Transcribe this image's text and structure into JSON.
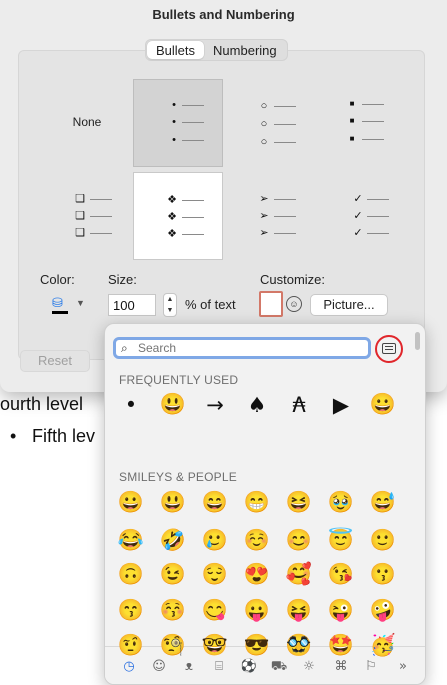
{
  "window": {
    "title": "Bullets and Numbering"
  },
  "tabs": [
    {
      "label": "Bullets",
      "active": true
    },
    {
      "label": "Numbering",
      "active": false
    }
  ],
  "bullet_grid": [
    {
      "type": "none",
      "label": "None",
      "symbols": []
    },
    {
      "type": "bullets",
      "symbol": "•",
      "selected": true
    },
    {
      "type": "bullets",
      "symbol": "○"
    },
    {
      "type": "bullets",
      "symbol": "■"
    },
    {
      "type": "bullets",
      "symbol": "❑"
    },
    {
      "type": "bullets",
      "symbol": "❖"
    },
    {
      "type": "bullets",
      "symbol": "➢"
    },
    {
      "type": "bullets",
      "symbol": "✓"
    }
  ],
  "format": {
    "color_label": "Color:",
    "size_label": "Size:",
    "size_value": "100",
    "size_suffix": "% of text",
    "customize_label": "Customize:",
    "picture_label": "Picture...",
    "reset_label": "Reset",
    "color_value": "#000000"
  },
  "document": {
    "line4": "ourth level",
    "line5_bullet": "•",
    "line5": "Fifth lev"
  },
  "emoji_picker": {
    "search_placeholder": "Search",
    "frequently_used_header": "FREQUENTLY USED",
    "frequently_used": [
      "•",
      "😃",
      "→",
      "♠",
      "₳",
      "▶",
      "😀"
    ],
    "smileys_header": "SMILEYS & PEOPLE",
    "smileys": [
      [
        "😀",
        "😃",
        "😄",
        "😁",
        "😆",
        "🥹",
        "😅"
      ],
      [
        "😂",
        "🤣",
        "🥲",
        "☺️",
        "😊",
        "😇",
        "🙂"
      ],
      [
        "🙃",
        "😉",
        "😌",
        "😍",
        "🥰",
        "😘",
        "😗"
      ],
      [
        "😙",
        "😚",
        "😋",
        "😛",
        "😝",
        "😜",
        "🤪"
      ],
      [
        "🤨",
        "🧐",
        "🤓",
        "😎",
        "🥸",
        "🤩",
        "🥳"
      ]
    ],
    "category_tabs": [
      "clock-icon",
      "smiley-icon",
      "bear-icon",
      "food-icon",
      "ball-icon",
      "car-icon",
      "bulb-icon",
      "symbols-icon",
      "flag-icon",
      "more-icon"
    ],
    "accent_color": "#2a6fe0"
  }
}
